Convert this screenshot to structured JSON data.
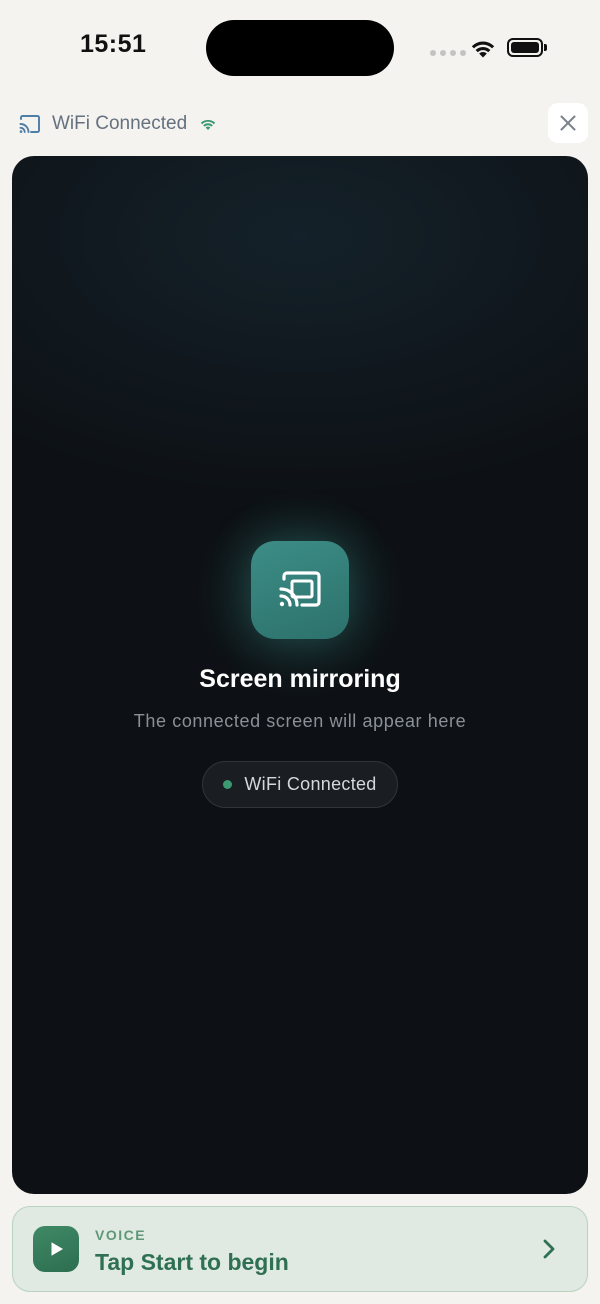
{
  "status_bar": {
    "time": "15:51",
    "icons": [
      "cellular-dots-icon",
      "wifi-icon",
      "battery-icon"
    ]
  },
  "header": {
    "connection_label": "WiFi Connected",
    "cast_icon": "cast-icon",
    "wifi_icon": "wifi-icon",
    "close_icon": "close-icon"
  },
  "mirror": {
    "icon": "screen-mirroring-icon",
    "title": "Screen mirroring",
    "subtitle": "The connected screen will appear here",
    "status_label": "WiFi Connected"
  },
  "voice_card": {
    "kicker": "VOICE",
    "title": "Tap Start to begin",
    "play_icon": "play-icon",
    "chevron_icon": "chevron-right-icon"
  },
  "colors": {
    "page_background": "#f5f3f0",
    "panel_background": "#0d1115",
    "accent_teal": "#3c8d86",
    "accent_green": "#2f6f52",
    "status_dot": "#3c9a72",
    "voice_card_background": "#e1eae2"
  }
}
